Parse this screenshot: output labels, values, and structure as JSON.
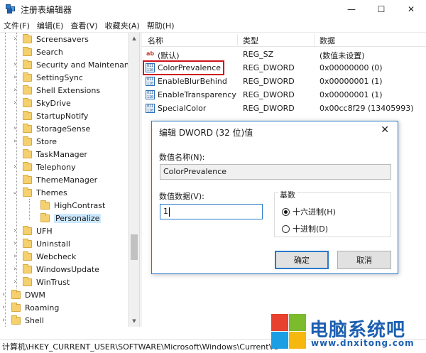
{
  "window": {
    "title": "注册表编辑器",
    "controls": [
      "—",
      "☐",
      "✕"
    ]
  },
  "menu": [
    "文件(F)",
    "编辑(E)",
    "查看(V)",
    "收藏夹(A)",
    "帮助(H)"
  ],
  "tree": [
    {
      "label": "Screensavers",
      "chev": "›"
    },
    {
      "label": "Search",
      "chev": ""
    },
    {
      "label": "Security and Maintenance",
      "chev": "›"
    },
    {
      "label": "SettingSync",
      "chev": "›"
    },
    {
      "label": "Shell Extensions",
      "chev": "›"
    },
    {
      "label": "SkyDrive",
      "chev": "›"
    },
    {
      "label": "StartupNotify",
      "chev": ""
    },
    {
      "label": "StorageSense",
      "chev": "›"
    },
    {
      "label": "Store",
      "chev": "›"
    },
    {
      "label": "TaskManager",
      "chev": ""
    },
    {
      "label": "Telephony",
      "chev": "›"
    },
    {
      "label": "ThemeManager",
      "chev": ""
    },
    {
      "label": "Themes",
      "chev": "⌄"
    },
    {
      "label": "HighContrast",
      "chev": ""
    },
    {
      "label": "Personalize",
      "chev": ""
    },
    {
      "label": "UFH",
      "chev": "›"
    },
    {
      "label": "Uninstall",
      "chev": "›"
    },
    {
      "label": "Webcheck",
      "chev": "›"
    },
    {
      "label": "WindowsUpdate",
      "chev": "›"
    },
    {
      "label": "WinTrust",
      "chev": "›"
    },
    {
      "label": "DWM",
      "chev": "›"
    },
    {
      "label": "Roaming",
      "chev": "›"
    },
    {
      "label": "Shell",
      "chev": "›"
    }
  ],
  "list": {
    "columns": [
      "名称",
      "类型",
      "数据"
    ],
    "rows": [
      {
        "icon": "ab",
        "name": "(默认)",
        "type": "REG_SZ",
        "data": "(数值未设置)"
      },
      {
        "icon": "bin",
        "name": "ColorPrevalence",
        "type": "REG_DWORD",
        "data": "0x00000000 (0)"
      },
      {
        "icon": "bin",
        "name": "EnableBlurBehind",
        "type": "REG_DWORD",
        "data": "0x00000001 (1)"
      },
      {
        "icon": "bin",
        "name": "EnableTransparency",
        "type": "REG_DWORD",
        "data": "0x00000001 (1)"
      },
      {
        "icon": "bin",
        "name": "SpecialColor",
        "type": "REG_DWORD",
        "data": "0x00cc8f29 (13405993)"
      }
    ]
  },
  "status": "计算机\\HKEY_CURRENT_USER\\SOFTWARE\\Microsoft\\Windows\\CurrentVe",
  "dialog": {
    "title": "编辑 DWORD (32 位)值",
    "close": "✕",
    "name_label": "数值名称(N):",
    "name_value": "ColorPrevalence",
    "data_label": "数值数据(V):",
    "data_value": "1",
    "base_label": "基数",
    "radio_hex": "十六进制(H)",
    "radio_dec": "十进制(D)",
    "ok": "确定",
    "cancel": "取消"
  },
  "watermark": {
    "text": "电脑系统吧",
    "url": "www.dnxitong.com"
  },
  "colors": {
    "accent": "#2b79c9",
    "highlight": "#d0121b",
    "folder": "#f5d06f",
    "selection": "#cce8ff"
  }
}
